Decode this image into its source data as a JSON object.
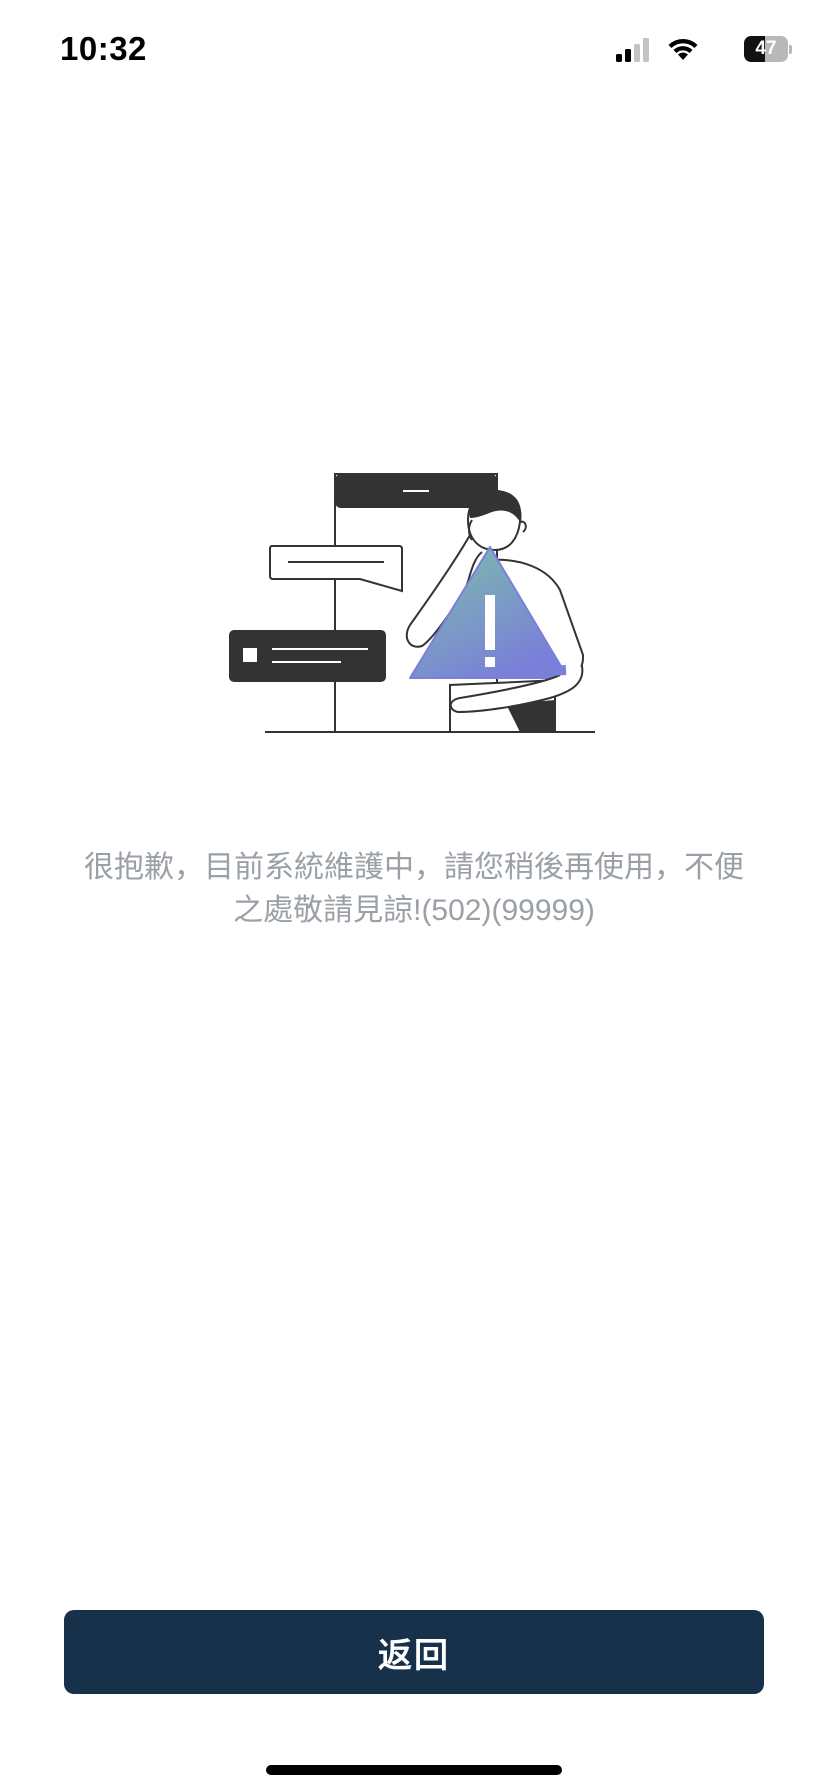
{
  "status_bar": {
    "time": "10:32",
    "battery_level": "47",
    "battery_fraction": 0.47,
    "signal_icon": "cellular-signal-icon",
    "wifi_icon": "wifi-icon"
  },
  "illustration": {
    "icon": "system-maintenance-illustration",
    "warning_gradient_start": "#7dbfaa",
    "warning_gradient_end": "#7a7fd9"
  },
  "message": {
    "text": "很抱歉，目前系統維護中，請您稍後再使用，不便之處敬請見諒!(502)(99999)"
  },
  "actions": {
    "back_label": "返回",
    "back_color": "#17314a"
  }
}
